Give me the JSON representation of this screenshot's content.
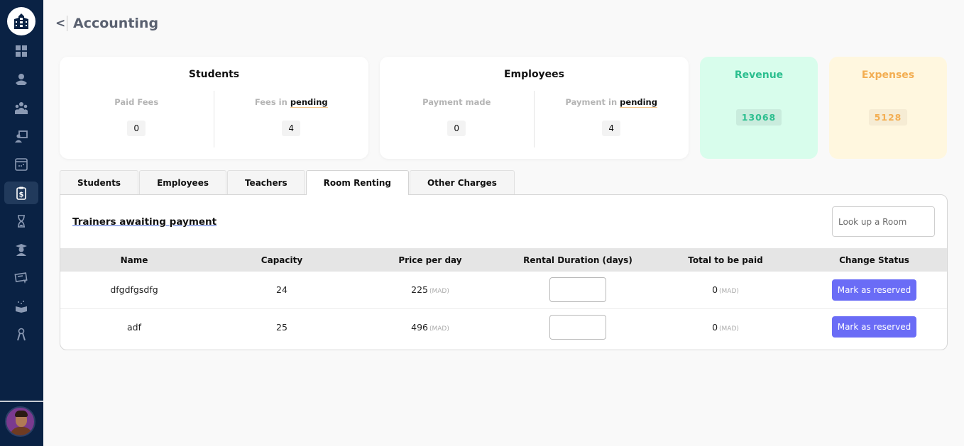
{
  "sidebar": {
    "logo_icon": "school-building-icon",
    "items": [
      {
        "icon": "dashboard-grid-icon",
        "active": false
      },
      {
        "icon": "reader-student-icon",
        "active": false
      },
      {
        "icon": "group-users-icon",
        "active": false
      },
      {
        "icon": "teacher-board-icon",
        "active": false
      },
      {
        "icon": "calendar-window-icon",
        "active": false
      },
      {
        "icon": "clipboard-dollar-icon",
        "active": true
      },
      {
        "icon": "hourglass-icon",
        "active": false
      },
      {
        "icon": "graduate-icon",
        "active": false
      },
      {
        "icon": "certificate-icon",
        "active": false
      },
      {
        "icon": "open-book-icon",
        "active": false
      },
      {
        "icon": "keys-icon",
        "active": false
      }
    ],
    "avatar": "user-avatar"
  },
  "header": {
    "back_label": "<",
    "title": "Accounting"
  },
  "summary": {
    "students": {
      "title": "Students",
      "left_label": "Paid Fees",
      "left_value": "0",
      "right_label_prefix": "Fees in ",
      "right_label_emph": "pending",
      "right_value": "4"
    },
    "employees": {
      "title": "Employees",
      "left_label": "Payment made",
      "left_value": "0",
      "right_label_prefix": "Payment in ",
      "right_label_emph": "pending",
      "right_value": "4"
    },
    "revenue": {
      "title": "Revenue",
      "value": "13068",
      "color": "#2cbf8f"
    },
    "expenses": {
      "title": "Expenses",
      "value": "5128",
      "color": "#f3ae52"
    }
  },
  "tabs": [
    {
      "label": "Students",
      "active": false
    },
    {
      "label": "Employees",
      "active": false
    },
    {
      "label": "Teachers",
      "active": false
    },
    {
      "label": "Room Renting",
      "active": true
    },
    {
      "label": "Other Charges",
      "active": false
    }
  ],
  "panel": {
    "title": "Trainers awaiting payment",
    "search_placeholder": "Look up a Room",
    "search_value": "",
    "columns": [
      "Name",
      "Capacity",
      "Price per day",
      "Rental Duration (days)",
      "Total to be paid",
      "Change Status"
    ],
    "currency": "(MAD)",
    "rows": [
      {
        "name": "dfgdfgsdfg",
        "capacity": "24",
        "price": "225",
        "duration": "",
        "total": "0",
        "action": "Mark as reserved"
      },
      {
        "name": "adf",
        "capacity": "25",
        "price": "496",
        "duration": "",
        "total": "0",
        "action": "Mark as reserved"
      }
    ],
    "accent": "#6a6cf6"
  }
}
